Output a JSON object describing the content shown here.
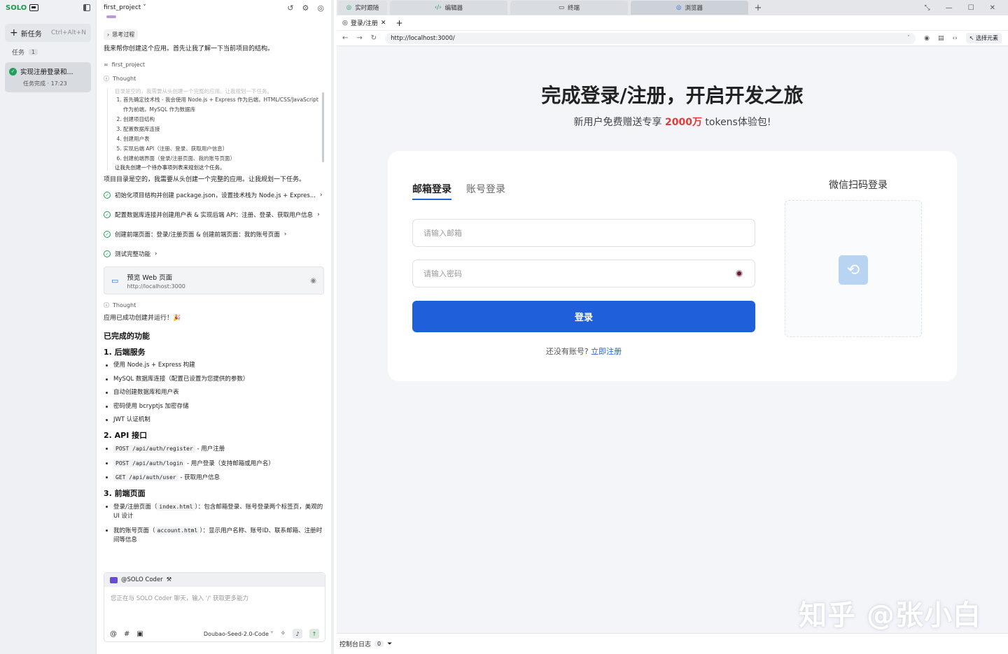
{
  "sidebar": {
    "logo": "SOLO",
    "new_task": "新任务",
    "new_task_shortcut": "Ctrl+Alt+N",
    "tasks_header": "任务",
    "tasks_count": "1",
    "task_title": "实现注册登录和...",
    "task_status": "任务完成 · 17:23"
  },
  "chat": {
    "project": "first_project",
    "thinking_pill": "思考过程",
    "intro": "我来帮你创建这个应用。首先让我了解一下当前项目的结构。",
    "project_ref": "first_project",
    "thought_label": "Thought",
    "thought_fade": "目录是空的，我需要从头创建一个完整的应用。让我规划一下任务。",
    "thought_items": [
      "首先确定技术栈 - 我会使用 Node.js + Express 作为后端，HTML/CSS/JavaScript 作为前端，MySQL 作为数据库",
      "创建项目结构",
      "配置数据库连接",
      "创建用户表",
      "实现后端 API（注册、登录、获取用户信息）",
      "创建前端界面（登录/注册页面、我的账号页面）"
    ],
    "thought_tail": "让我先创建一个待办事项列表来规划这个任务。",
    "plan_text": "项目目录是空的，我需要从头创建一个完整的应用。让我规划一下任务。",
    "steps": [
      "初始化项目结构并创建 package.json，设置技术栈为 Node.js + Expres...",
      "配置数据库连接并创建用户表 & 实现后端 API：注册、登录、获取用户信息",
      "创建前端页面：登录/注册页面 & 创建前端页面：我的账号页面",
      "测试完整功能"
    ],
    "preview_title": "预览 Web 页面",
    "preview_url": "http://localhost:3000",
    "thought_label2": "Thought",
    "done_text": "应用已成功创建并运行！🎉",
    "h_done": "已完成的功能",
    "h_backend": "1. 后端服务",
    "backend_items": [
      "使用 Node.js + Express 构建",
      "MySQL 数据库连接（配置已设置为您提供的参数）",
      "自动创建数据库和用户表",
      "密码使用 bcryptjs 加密存储",
      "JWT 认证机制"
    ],
    "h_api": "2. API 接口",
    "api_items": [
      {
        "code": "POST /api/auth/register",
        "desc": " - 用户注册"
      },
      {
        "code": "POST /api/auth/login",
        "desc": " - 用户登录（支持邮箱或用户名）"
      },
      {
        "code": "GET /api/auth/user",
        "desc": " - 获取用户信息"
      }
    ],
    "h_front": "3. 前端页面",
    "front_items": [
      {
        "pre": "登录/注册页面（",
        "code": "index.html",
        "post": "）：包含邮箱登录、账号登录两个标签页，美观的 UI 设计"
      },
      {
        "pre": "我的账号页面（",
        "code": "account.html",
        "post": "）：显示用户名称、账号ID、联系邮箱、注册时间等信息"
      }
    ],
    "composer_agent": "@SOLO Coder",
    "composer_placeholder": "您正在与 SOLO Coder 聊天，输入 '/' 获取更多能力",
    "model": "Doubao-Seed-2.0-Code"
  },
  "tabs": [
    "实时跟随",
    "编辑器",
    "终端",
    "浏览器"
  ],
  "browser": {
    "page_tab": "登录/注册",
    "url": "http://localhost:3000/",
    "pick_element": "选择元素"
  },
  "page": {
    "title": "完成登录/注册，开启开发之旅",
    "subtitle_pre": "新用户免费赠送专享 ",
    "subtitle_highlight": "2000万",
    "subtitle_post": " tokens体验包!",
    "tab_email": "邮箱登录",
    "tab_account": "账号登录",
    "email_placeholder": "请输入邮箱",
    "password_placeholder": "请输入密码",
    "login_button": "登录",
    "no_account": "还没有账号?",
    "register_link": "立即注册",
    "wechat_title": "微信扫码登录",
    "watermark": "知乎 @张小白"
  },
  "console": {
    "label": "控制台日志",
    "count": "0"
  },
  "colors": {
    "accent": "#1f5fd9",
    "success": "#20a058",
    "highlight": "#e23b3b"
  }
}
